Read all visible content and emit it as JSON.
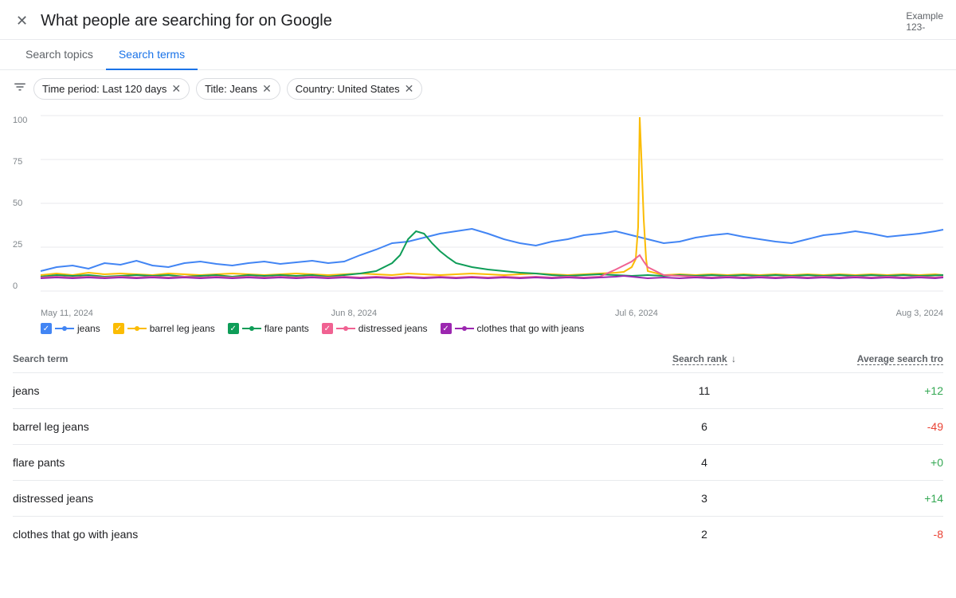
{
  "header": {
    "title": "What people are searching for on Google",
    "example_label": "Example",
    "example_number": "123-"
  },
  "tabs": [
    {
      "id": "search-topics",
      "label": "Search topics",
      "active": false
    },
    {
      "id": "search-terms",
      "label": "Search terms",
      "active": true
    }
  ],
  "filters": {
    "icon": "▼",
    "chips": [
      {
        "id": "time-period",
        "label": "Time period: Last 120 days"
      },
      {
        "id": "title",
        "label": "Title: Jeans"
      },
      {
        "id": "country",
        "label": "Country: United States"
      }
    ]
  },
  "chart": {
    "y_labels": [
      "100",
      "75",
      "50",
      "25",
      "0"
    ],
    "x_labels": [
      "May 11, 2024",
      "Jun 8, 2024",
      "Jul 6, 2024",
      "Aug 3, 2024"
    ],
    "colors": {
      "jeans": "#4285f4",
      "barrel_leg_jeans": "#fbbc04",
      "flare_pants": "#0f9d58",
      "distressed_jeans": "#f06292",
      "clothes_that_go_with_jeans": "#9c27b0"
    }
  },
  "legend": [
    {
      "id": "jeans",
      "label": "jeans",
      "color": "#4285f4"
    },
    {
      "id": "barrel-leg-jeans",
      "label": "barrel leg jeans",
      "color": "#fbbc04"
    },
    {
      "id": "flare-pants",
      "label": "flare pants",
      "color": "#0f9d58"
    },
    {
      "id": "distressed-jeans",
      "label": "distressed jeans",
      "color": "#f06292"
    },
    {
      "id": "clothes-that-go-with-jeans",
      "label": "clothes that go with jeans",
      "color": "#9c27b0"
    }
  ],
  "table": {
    "headers": {
      "term": "Search term",
      "rank": "Search rank",
      "trend": "Average search tro"
    },
    "rows": [
      {
        "term": "jeans",
        "rank": "11",
        "trend": "+12",
        "trend_type": "pos"
      },
      {
        "term": "barrel leg jeans",
        "rank": "6",
        "trend": "-49",
        "trend_type": "neg"
      },
      {
        "term": "flare pants",
        "rank": "4",
        "trend": "+0",
        "trend_type": "neu"
      },
      {
        "term": "distressed jeans",
        "rank": "3",
        "trend": "+14",
        "trend_type": "pos"
      },
      {
        "term": "clothes that go with jeans",
        "rank": "2",
        "trend": "-8",
        "trend_type": "neg"
      }
    ]
  }
}
